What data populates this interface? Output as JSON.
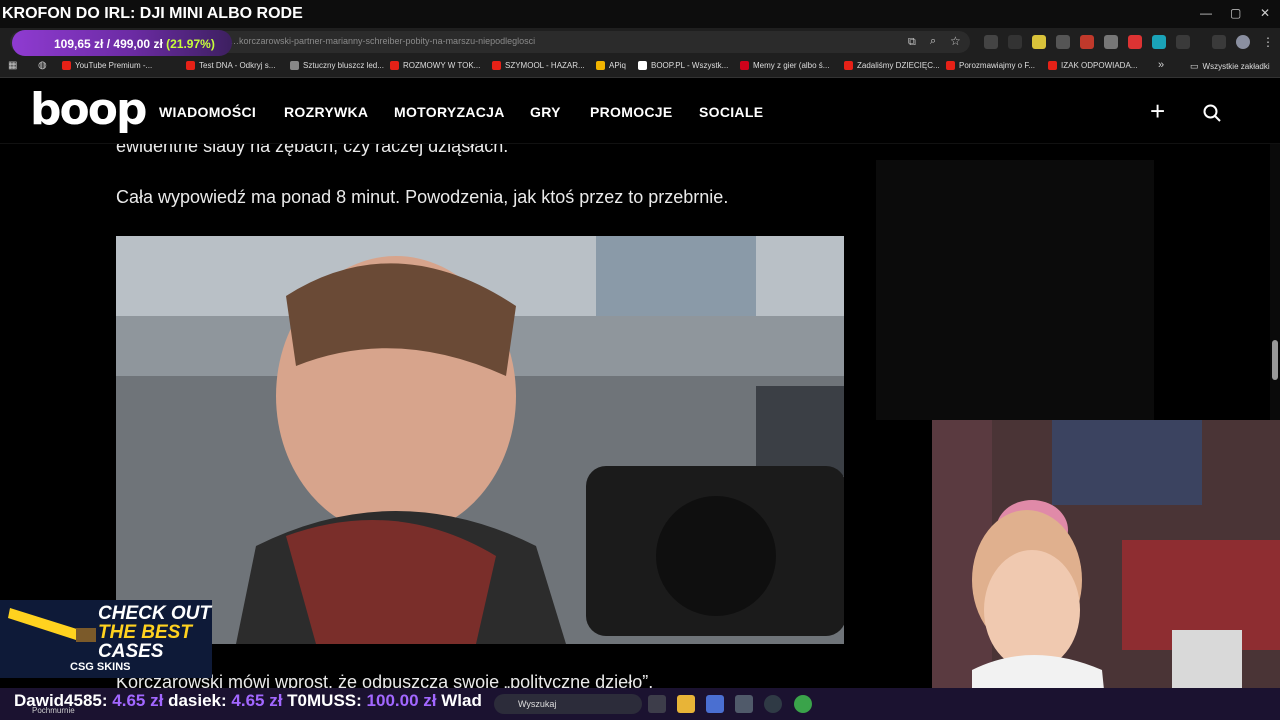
{
  "stream": {
    "title": "KROFON DO IRL: DJI MINI ALBO RODE",
    "donation_goal": {
      "current": "109,65 zł",
      "separator": "/",
      "target": "499,00 zł",
      "percent": "(21.97%)",
      "progress": 0.2197,
      "color": "#8f3bd1"
    }
  },
  "browser": {
    "url": "…korczarowski-partner-marianny-schreiber-pobity-na-marszu-niepodleglosci",
    "window_controls": [
      "—",
      "▢",
      "✕"
    ],
    "bookmarks": [
      {
        "label": "YouTube Premium -...",
        "color": "#e62117"
      },
      {
        "label": "Test DNA - Odkryj s...",
        "color": "#e62117"
      },
      {
        "label": "Sztuczny bluszcz led...",
        "color": "#888888"
      },
      {
        "label": "ROZMOWY W TOK...",
        "color": "#e62117"
      },
      {
        "label": "SZYMOOL - HAZAR...",
        "color": "#e62117"
      },
      {
        "label": "APiq",
        "color": "#f1b400"
      },
      {
        "label": "BOOP.PL - Wszystk...",
        "color": "#ffffff"
      },
      {
        "label": "Memy z gier (albo ś...",
        "color": "#d0021b"
      },
      {
        "label": "Zadaliśmy DZIECIĘC...",
        "color": "#e62117"
      },
      {
        "label": "Porozmawiajmy o F...",
        "color": "#e62117"
      },
      {
        "label": "IZAK ODPOWIADA...",
        "color": "#e62117"
      }
    ],
    "bookmarks_overflow": "»",
    "all_bookmarks": "Wszystkie zakładki"
  },
  "site": {
    "logo": "boop",
    "nav": [
      "WIADOMOŚCI",
      "ROZRYWKA",
      "MOTORYZACJA",
      "GRY",
      "PROMOCJE",
      "SOCIALE"
    ],
    "plus_icon": "+",
    "search_icon": "search-icon"
  },
  "article": {
    "partial_top": "ewidentne ślady na zębach, czy raczej dziąsłach.",
    "para1": "Cała wypowiedź ma ponad 8 minut. Powodzenia, jak ktoś przez to przebrnie.",
    "partial_bottom": "Korczarowski mówi wprost, że odpuszcza swoje „polityczne dzieło”."
  },
  "ad": {
    "line1": "CHECK OUT",
    "line2": "THE BEST",
    "line3": "CASES",
    "brand": "CSG SKINS"
  },
  "ticker": [
    {
      "name": "Dawid4585:",
      "amount": "4.65 zł"
    },
    {
      "name": "dasiek:",
      "amount": "4.65 zł"
    },
    {
      "name": "T0MUSS:",
      "amount": "100.00 zł"
    },
    {
      "name": "Wlad",
      "amount": ""
    }
  ],
  "taskbar": {
    "weather": "Pochmurnie",
    "search_placeholder": "Wyszukaj"
  }
}
